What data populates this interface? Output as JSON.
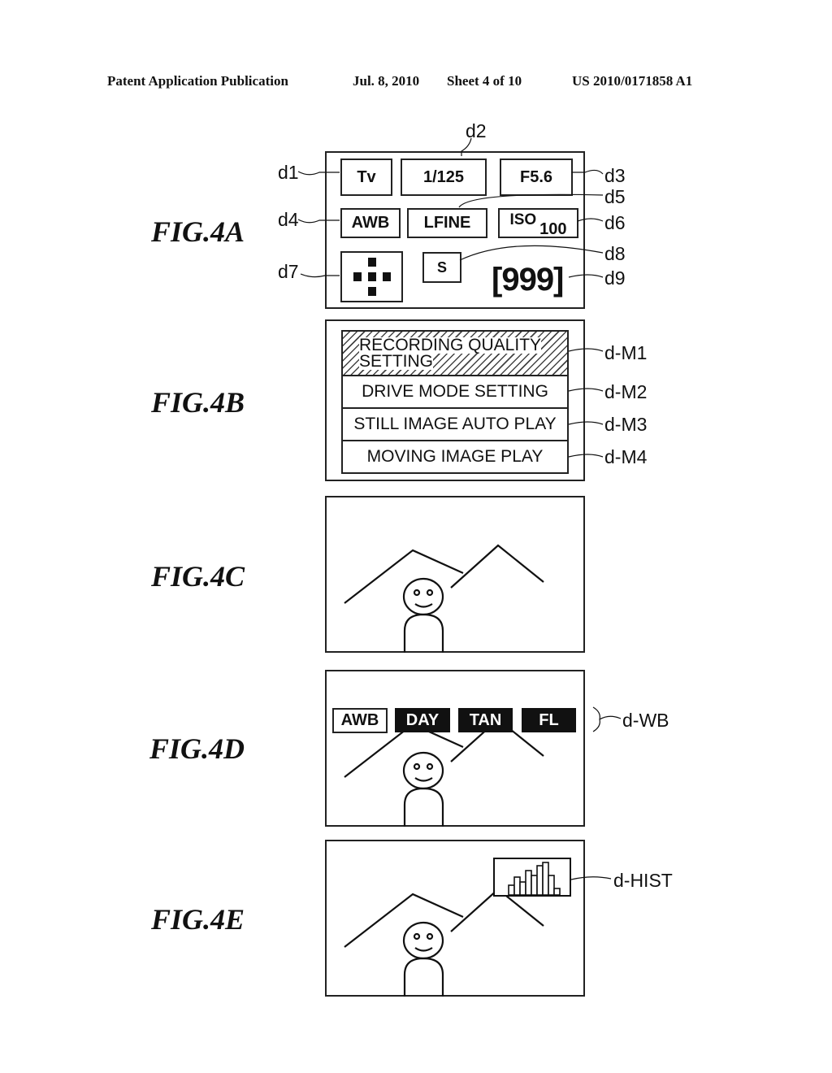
{
  "header": {
    "publication": "Patent Application Publication",
    "date": "Jul. 8, 2010",
    "sheet": "Sheet 4 of 10",
    "number": "US 2010/0171858 A1"
  },
  "figures": {
    "fig4a": {
      "label": "FIG.4A",
      "items": {
        "d1": {
          "ref": "d1",
          "value": "Tv"
        },
        "d2": {
          "ref": "d2",
          "value": "1/125"
        },
        "d3": {
          "ref": "d3",
          "value": "F5.6"
        },
        "d4": {
          "ref": "d4",
          "value": "AWB"
        },
        "d5": {
          "ref": "d5",
          "value": "LFINE"
        },
        "d6": {
          "ref": "d6",
          "value_prefix": "ISO",
          "value_suffix": "100"
        },
        "d7": {
          "ref": "d7",
          "icon": "af-point-cross-icon"
        },
        "d8": {
          "ref": "d8",
          "value": "S"
        },
        "d9": {
          "ref": "d9",
          "value": "[999]"
        }
      }
    },
    "fig4b": {
      "label": "FIG.4B",
      "menu": [
        {
          "ref": "d-M1",
          "line1": "RECORDING QUALITY",
          "line2": "SETTING",
          "selected": true
        },
        {
          "ref": "d-M2",
          "text": "DRIVE MODE SETTING"
        },
        {
          "ref": "d-M3",
          "text": "STILL IMAGE AUTO PLAY"
        },
        {
          "ref": "d-M4",
          "text": "MOVING IMAGE PLAY"
        }
      ]
    },
    "fig4c": {
      "label": "FIG.4C"
    },
    "fig4d": {
      "label": "FIG.4D",
      "ref": "d-WB",
      "wb_options": [
        {
          "text": "AWB",
          "selected": true
        },
        {
          "text": "DAY",
          "selected": false
        },
        {
          "text": "TAN",
          "selected": false
        },
        {
          "text": "FL",
          "selected": false
        }
      ]
    },
    "fig4e": {
      "label": "FIG.4E",
      "ref": "d-HIST",
      "histogram_relative_heights": [
        0,
        0.3,
        0.55,
        0.4,
        0.75,
        0.6,
        0.9,
        1.0,
        0.6,
        0.2,
        0
      ]
    }
  }
}
